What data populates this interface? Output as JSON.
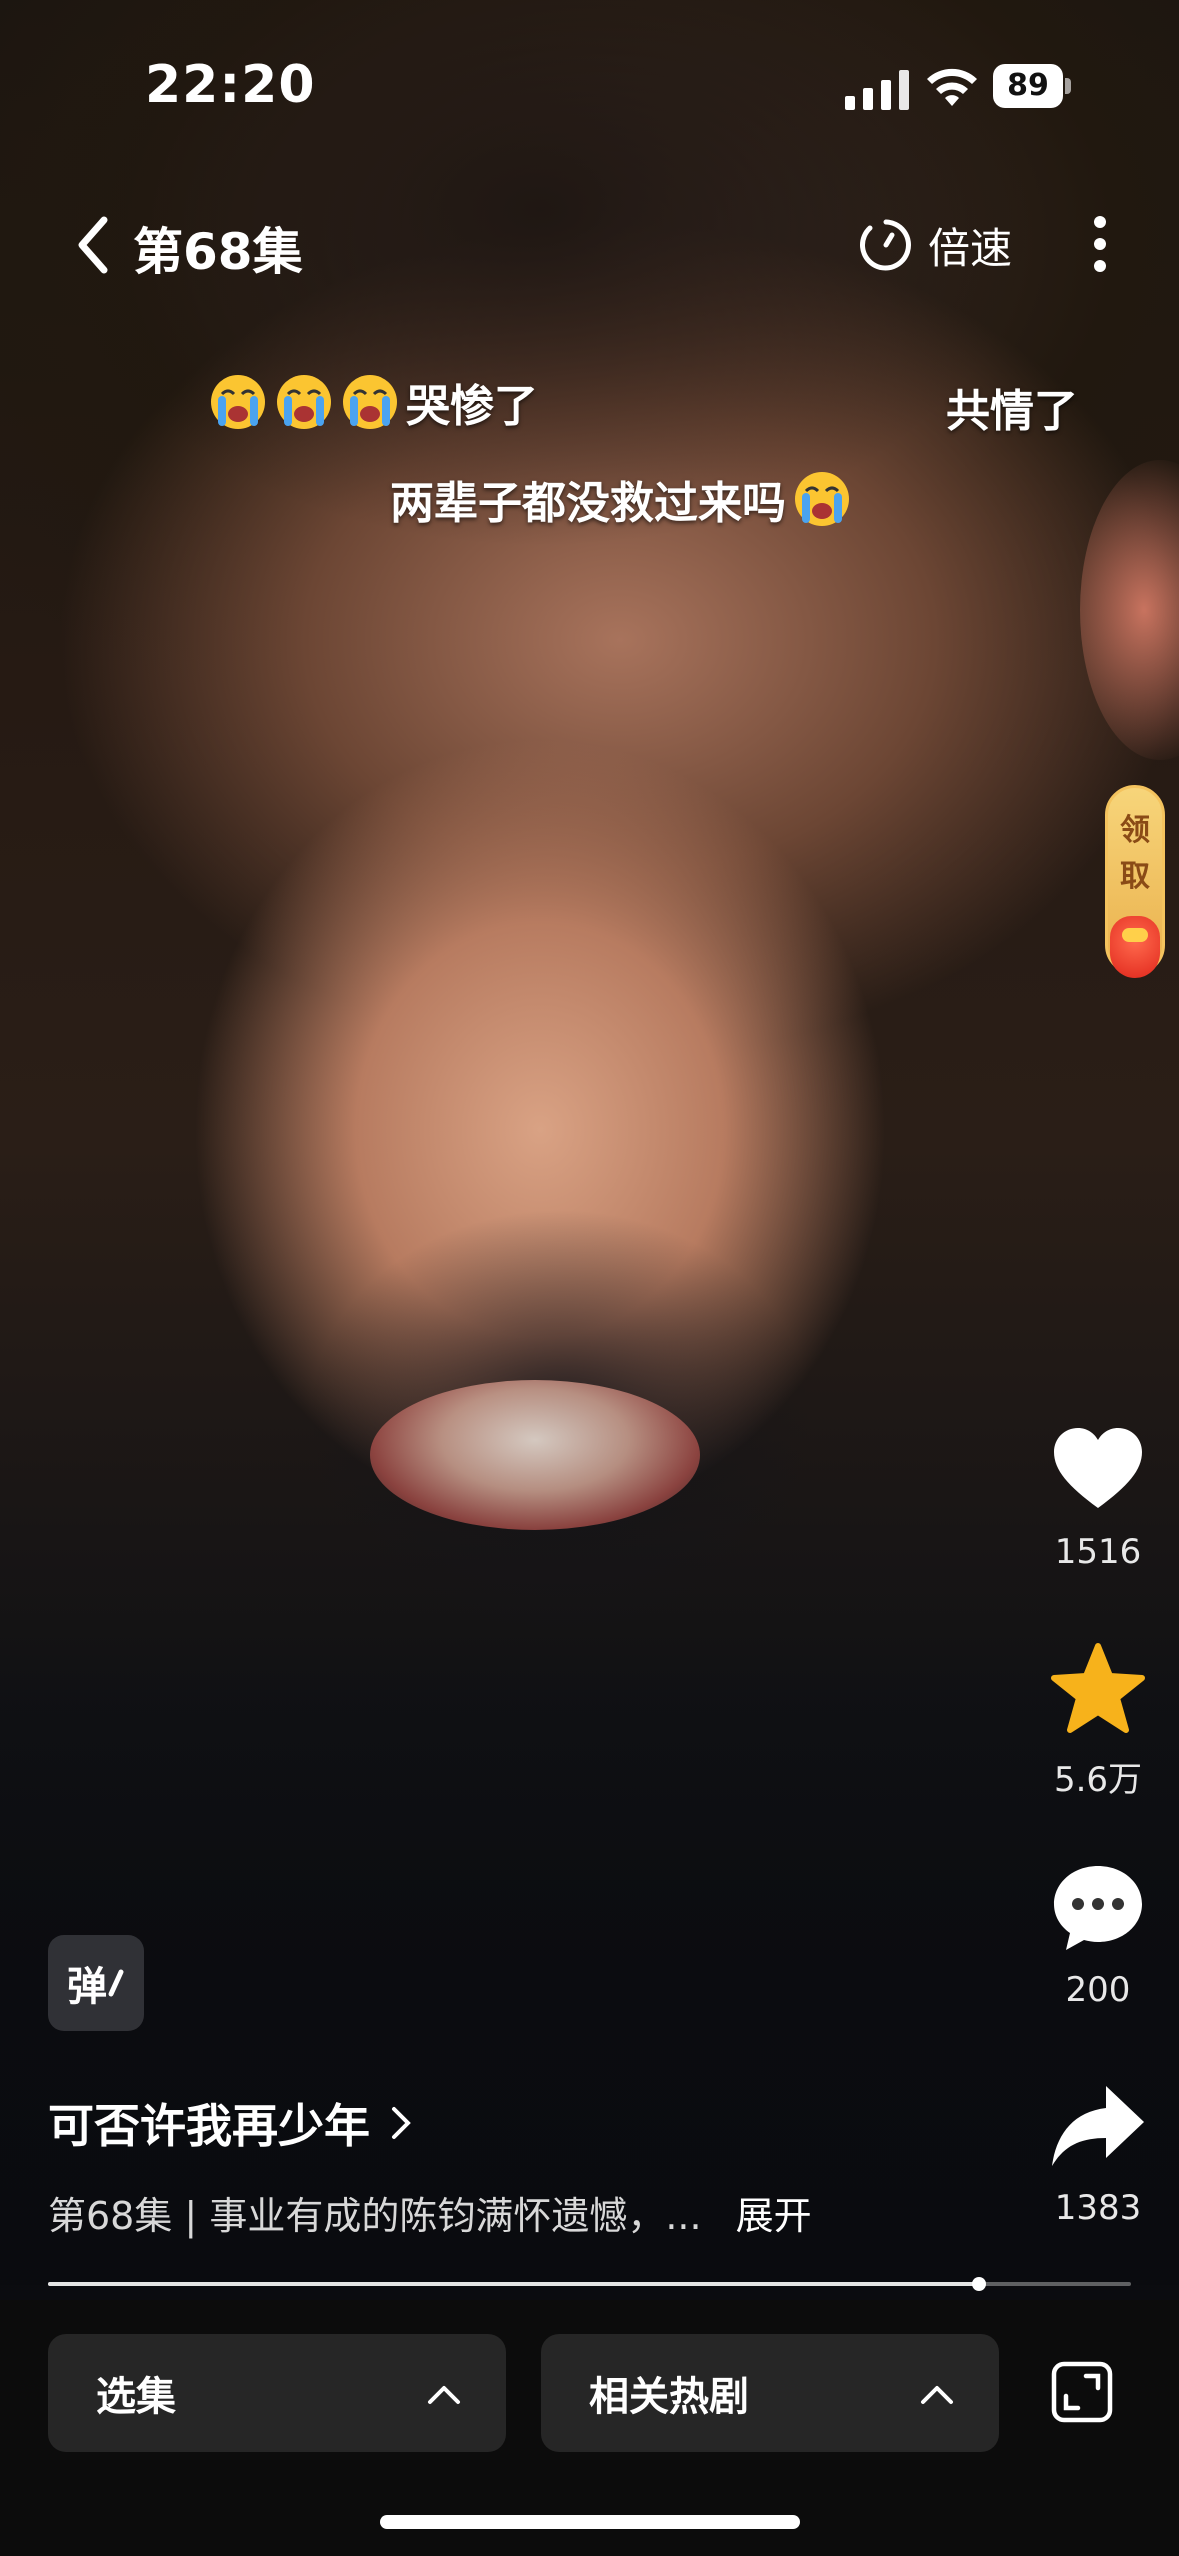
{
  "status_bar": {
    "time": "22:20",
    "battery": "89"
  },
  "top_nav": {
    "episode_title": "第68集",
    "speed_label": "倍速"
  },
  "danmaku": {
    "line1_text": "哭惨了",
    "line1_right": "共情了",
    "line2_text": "两辈子都没救过来吗"
  },
  "reward": {
    "label_1": "领",
    "label_2": "取"
  },
  "actions": {
    "likes": "1516",
    "favorites": "5.6万",
    "comments": "200",
    "shares": "1383"
  },
  "danmaku_toggle_label": "弹",
  "caption": {
    "show_title": "可否许我再少年",
    "description": "第68集 | 事业有成的陈钧满怀遗憾，...",
    "expand_label": "展开"
  },
  "progress": {
    "fraction": 0.86
  },
  "bottom": {
    "episodes_label": "选集",
    "related_label": "相关热剧"
  },
  "colors": {
    "favorite_star": "#F7B21B",
    "reward_pill": "#EAB04C",
    "pill_bg": "#262626"
  }
}
